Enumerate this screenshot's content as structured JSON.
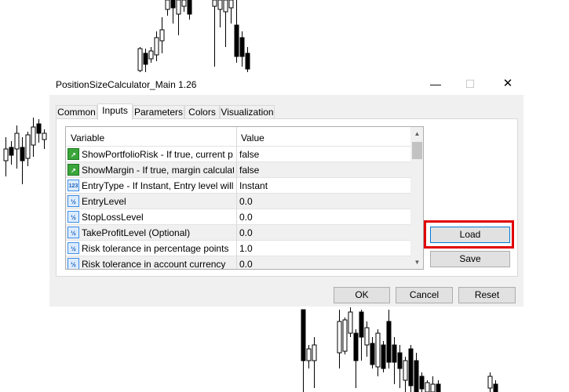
{
  "window": {
    "title": "PositionSizeCalculator_Main 1.26",
    "minimize_glyph": "—",
    "maximize_glyph": "☐",
    "close_glyph": "✕"
  },
  "tabs": [
    {
      "label": "Common",
      "active": false
    },
    {
      "label": "Inputs",
      "active": true
    },
    {
      "label": "Parameters",
      "active": false
    },
    {
      "label": "Colors",
      "active": false
    },
    {
      "label": "Visualization",
      "active": false
    }
  ],
  "grid": {
    "header": {
      "variable": "Variable",
      "value": "Value"
    },
    "rows": [
      {
        "icon": "bool-icon",
        "icon_text": "↗",
        "variable": "ShowPortfolioRisk - If true, current p...",
        "value": "false"
      },
      {
        "icon": "bool-icon",
        "icon_text": "↗",
        "variable": "ShowMargin - If true, margin calculati...",
        "value": "false"
      },
      {
        "icon": "enum-icon",
        "icon_text": "123",
        "variable": "EntryType - If Instant, Entry level will...",
        "value": "Instant"
      },
      {
        "icon": "double-icon",
        "icon_text": "½",
        "variable": "EntryLevel",
        "value": "0.0"
      },
      {
        "icon": "double-icon",
        "icon_text": "½",
        "variable": "StopLossLevel",
        "value": "0.0"
      },
      {
        "icon": "double-icon",
        "icon_text": "½",
        "variable": "TakeProfitLevel (Optional)",
        "value": "0.0"
      },
      {
        "icon": "double-icon",
        "icon_text": "½",
        "variable": "Risk tolerance in percentage points",
        "value": "1.0"
      },
      {
        "icon": "double-icon",
        "icon_text": "½",
        "variable": "Risk tolerance in account currency",
        "value": "0.0"
      }
    ],
    "scroll_up": "▲",
    "scroll_down": "▼"
  },
  "buttons": {
    "load": "Load",
    "save": "Save",
    "ok": "OK",
    "cancel": "Cancel",
    "reset": "Reset"
  },
  "colors": {
    "highlight": "#e00000",
    "candle": "#000000"
  }
}
